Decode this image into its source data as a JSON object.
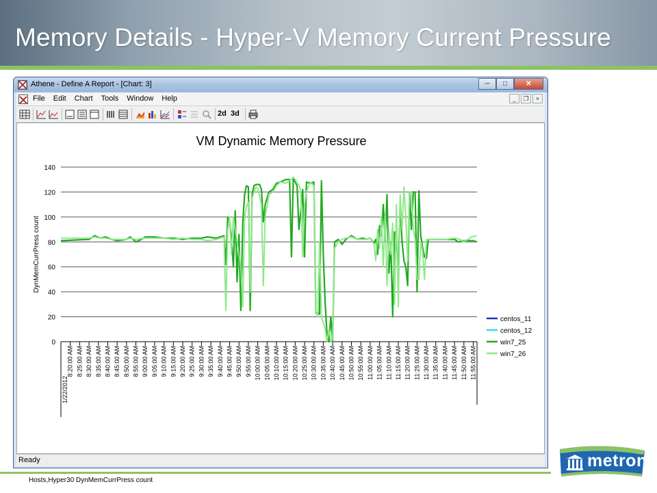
{
  "slide": {
    "title": "Memory Details - Hyper-V Memory Current Pressure"
  },
  "window": {
    "title": "Athene - Define A Report - [Chart: 3]",
    "menu": [
      "File",
      "Edit",
      "Chart",
      "Tools",
      "Window",
      "Help"
    ],
    "toolbar": {
      "label_2d": "2d",
      "label_3d": "3d"
    },
    "status": "Ready"
  },
  "logo": {
    "text": "metron"
  },
  "colors": {
    "header_green": "#8cc266",
    "series_centos_11": "#1f2fbf",
    "series_centos_12": "#33ddee",
    "series_win7_25": "#22a822",
    "series_win7_26": "#8ee88a"
  },
  "chart_data": {
    "type": "line",
    "title": "VM Dynamic Memory Pressure",
    "ylabel": "DynMemCurrPress count",
    "xlabel": "",
    "footnote": "Hosts,Hyper30 DynMemCurrPress count",
    "date_label": "1/22/2012",
    "ylim": [
      0,
      140
    ],
    "yticks": [
      0,
      20,
      40,
      60,
      80,
      100,
      120,
      140
    ],
    "grid": true,
    "legend_position": "right",
    "x_ticks": [
      "8:20:00 AM",
      "8:25:00 AM",
      "8:30:00 AM",
      "8:35:00 AM",
      "8:40:00 AM",
      "8:45:00 AM",
      "8:50:00 AM",
      "8:55:00 AM",
      "9:00:00 AM",
      "9:05:00 AM",
      "9:10:00 AM",
      "9:15:00 AM",
      "9:20:00 AM",
      "9:25:00 AM",
      "9:30:00 AM",
      "9:35:00 AM",
      "9:40:00 AM",
      "9:45:00 AM",
      "9:50:00 AM",
      "9:55:00 AM",
      "10:00:00 AM",
      "10:05:00 AM",
      "10:10:00 AM",
      "10:15:00 AM",
      "10:20:00 AM",
      "10:25:00 AM",
      "10:30:00 AM",
      "10:35:00 AM",
      "10:40:00 AM",
      "10:45:00 AM",
      "10:50:00 AM",
      "10:55:00 AM",
      "11:00:00 AM",
      "11:05:00 AM",
      "11:10:00 AM",
      "11:15:00 AM",
      "11:20:00 AM",
      "11:25:00 AM",
      "11:30:00 AM",
      "11:35:00 AM",
      "11:40:00 AM",
      "11:45:00 AM",
      "11:50:00 AM",
      "11:55:00 AM"
    ],
    "x_range": [
      "8:15 AM",
      "11:57 AM"
    ],
    "series": [
      {
        "name": "centos_11",
        "color": "#1f2fbf",
        "points": []
      },
      {
        "name": "centos_12",
        "color": "#33ddee",
        "points": []
      },
      {
        "name": "win7_25",
        "color": "#22a822",
        "points": [
          [
            "8:15",
            81
          ],
          [
            "8:30",
            82
          ],
          [
            "8:33",
            85
          ],
          [
            "8:36",
            83
          ],
          [
            "8:39",
            84
          ],
          [
            "8:42",
            82
          ],
          [
            "8:45",
            81
          ],
          [
            "8:50",
            82
          ],
          [
            "8:52",
            84
          ],
          [
            "8:55",
            80
          ],
          [
            "8:58",
            82
          ],
          [
            "9:00",
            84
          ],
          [
            "9:05",
            84
          ],
          [
            "9:10",
            83
          ],
          [
            "9:15",
            83
          ],
          [
            "9:20",
            82
          ],
          [
            "9:25",
            83
          ],
          [
            "9:30",
            83
          ],
          [
            "9:33",
            84
          ],
          [
            "9:38",
            83
          ],
          [
            "9:40",
            84
          ],
          [
            "9:42",
            85
          ],
          [
            "9:43",
            62
          ],
          [
            "9:44",
            100
          ],
          [
            "9:45",
            95
          ],
          [
            "9:46",
            84
          ],
          [
            "9:47",
            60
          ],
          [
            "9:48",
            105
          ],
          [
            "9:49",
            48
          ],
          [
            "9:50",
            86
          ],
          [
            "9:51",
            25
          ],
          [
            "9:52",
            95
          ],
          [
            "9:53",
            118
          ],
          [
            "9:54",
            125
          ],
          [
            "9:55",
            124
          ],
          [
            "9:56",
            25
          ],
          [
            "9:57",
            118
          ],
          [
            "9:58",
            125
          ],
          [
            "9:59",
            126
          ],
          [
            "10:01",
            126
          ],
          [
            "10:02",
            122
          ],
          [
            "10:03",
            96
          ],
          [
            "10:04",
            110
          ],
          [
            "10:06",
            120
          ],
          [
            "10:08",
            122
          ],
          [
            "10:10",
            127
          ],
          [
            "10:12",
            128
          ],
          [
            "10:15",
            130
          ],
          [
            "10:17",
            130
          ],
          [
            "10:18",
            68
          ],
          [
            "10:19",
            131
          ],
          [
            "10:20",
            128
          ],
          [
            "10:21",
            125
          ],
          [
            "10:22",
            90
          ],
          [
            "10:23",
            105
          ],
          [
            "10:24",
            122
          ],
          [
            "10:25",
            68
          ],
          [
            "10:26",
            128
          ],
          [
            "10:28",
            127
          ],
          [
            "10:30",
            128
          ],
          [
            "10:31",
            23
          ],
          [
            "10:32",
            23
          ],
          [
            "10:33",
            22
          ],
          [
            "10:34",
            129
          ],
          [
            "10:35",
            70
          ],
          [
            "10:36",
            30
          ],
          [
            "10:37",
            5
          ],
          [
            "10:38",
            0
          ],
          [
            "10:39",
            20
          ],
          [
            "10:40",
            0
          ],
          [
            "10:41",
            80
          ],
          [
            "10:43",
            82
          ],
          [
            "10:45",
            78
          ],
          [
            "10:47",
            82
          ],
          [
            "10:50",
            85
          ],
          [
            "10:53",
            82
          ],
          [
            "10:56",
            83
          ],
          [
            "10:58",
            82
          ],
          [
            "11:00",
            83
          ],
          [
            "11:02",
            79
          ],
          [
            "11:03",
            82
          ],
          [
            "11:04",
            70
          ],
          [
            "11:05",
            93
          ],
          [
            "11:06",
            85
          ],
          [
            "11:07",
            110
          ],
          [
            "11:08",
            80
          ],
          [
            "11:09",
            118
          ],
          [
            "11:10",
            55
          ],
          [
            "11:11",
            80
          ],
          [
            "11:12",
            20
          ],
          [
            "11:13",
            88
          ],
          [
            "11:14",
            85
          ],
          [
            "11:15",
            55
          ],
          [
            "11:16",
            110
          ],
          [
            "11:17",
            80
          ],
          [
            "11:18",
            65
          ],
          [
            "11:19",
            60
          ],
          [
            "11:20",
            45
          ],
          [
            "11:21",
            120
          ],
          [
            "11:22",
            90
          ],
          [
            "11:23",
            120
          ],
          [
            "11:24",
            120
          ],
          [
            "11:25",
            40
          ],
          [
            "11:26",
            121
          ],
          [
            "11:27",
            85
          ],
          [
            "11:28",
            75
          ],
          [
            "11:29",
            68
          ],
          [
            "11:30",
            67
          ],
          [
            "11:31",
            82
          ],
          [
            "11:35",
            82
          ],
          [
            "11:40",
            82
          ],
          [
            "11:45",
            82
          ],
          [
            "11:47",
            80
          ],
          [
            "11:50",
            81
          ],
          [
            "11:55",
            81
          ],
          [
            "11:57",
            80
          ]
        ]
      },
      {
        "name": "win7_26",
        "color": "#8ee88a",
        "points": [
          [
            "8:15",
            83
          ],
          [
            "8:30",
            83
          ],
          [
            "8:33",
            84
          ],
          [
            "8:36",
            83
          ],
          [
            "8:39",
            83
          ],
          [
            "8:42",
            82
          ],
          [
            "8:45",
            82
          ],
          [
            "8:50",
            82
          ],
          [
            "8:52",
            83
          ],
          [
            "8:55",
            82
          ],
          [
            "9:00",
            83
          ],
          [
            "9:05",
            83
          ],
          [
            "9:10",
            83
          ],
          [
            "9:15",
            82
          ],
          [
            "9:20",
            83
          ],
          [
            "9:25",
            82
          ],
          [
            "9:30",
            82
          ],
          [
            "9:33",
            81
          ],
          [
            "9:38",
            82
          ],
          [
            "9:40",
            83
          ],
          [
            "9:42",
            84
          ],
          [
            "9:43",
            25
          ],
          [
            "9:44",
            90
          ],
          [
            "9:45",
            100
          ],
          [
            "9:46",
            70
          ],
          [
            "9:47",
            100
          ],
          [
            "9:48",
            90
          ],
          [
            "9:49",
            80
          ],
          [
            "9:50",
            70
          ],
          [
            "9:51",
            60
          ],
          [
            "9:52",
            28
          ],
          [
            "9:53",
            100
          ],
          [
            "9:54",
            108
          ],
          [
            "9:55",
            112
          ],
          [
            "9:56",
            40
          ],
          [
            "9:57",
            115
          ],
          [
            "9:58",
            120
          ],
          [
            "9:59",
            124
          ],
          [
            "10:00",
            123
          ],
          [
            "10:02",
            110
          ],
          [
            "10:03",
            45
          ],
          [
            "10:04",
            100
          ],
          [
            "10:06",
            118
          ],
          [
            "10:08",
            120
          ],
          [
            "10:10",
            125
          ],
          [
            "10:12",
            128
          ],
          [
            "10:15",
            127
          ],
          [
            "10:17",
            129
          ],
          [
            "10:18",
            130
          ],
          [
            "10:19",
            132
          ],
          [
            "10:20",
            130
          ],
          [
            "10:21",
            127
          ],
          [
            "10:22",
            126
          ],
          [
            "10:23",
            120
          ],
          [
            "10:24",
            68
          ],
          [
            "10:25",
            110
          ],
          [
            "10:26",
            120
          ],
          [
            "10:28",
            128
          ],
          [
            "10:30",
            125
          ],
          [
            "10:31",
            24
          ],
          [
            "10:32",
            20
          ],
          [
            "10:33",
            80
          ],
          [
            "10:34",
            20
          ],
          [
            "10:35",
            15
          ],
          [
            "10:36",
            10
          ],
          [
            "10:37",
            0
          ],
          [
            "10:38",
            10
          ],
          [
            "10:39",
            0
          ],
          [
            "10:40",
            2
          ],
          [
            "10:41",
            75
          ],
          [
            "10:43",
            80
          ],
          [
            "10:45",
            82
          ],
          [
            "10:47",
            83
          ],
          [
            "10:50",
            84
          ],
          [
            "10:53",
            82
          ],
          [
            "10:56",
            82
          ],
          [
            "10:58",
            82
          ],
          [
            "11:00",
            83
          ],
          [
            "11:02",
            78
          ],
          [
            "11:03",
            65
          ],
          [
            "11:04",
            90
          ],
          [
            "11:05",
            75
          ],
          [
            "11:06",
            100
          ],
          [
            "11:07",
            60
          ],
          [
            "11:08",
            103
          ],
          [
            "11:09",
            45
          ],
          [
            "11:10",
            88
          ],
          [
            "11:11",
            70
          ],
          [
            "11:12",
            95
          ],
          [
            "11:13",
            30
          ],
          [
            "11:14",
            110
          ],
          [
            "11:15",
            28
          ],
          [
            "11:16",
            118
          ],
          [
            "11:17",
            90
          ],
          [
            "11:18",
            124
          ],
          [
            "11:19",
            100
          ],
          [
            "11:20",
            65
          ],
          [
            "11:21",
            120
          ],
          [
            "11:22",
            118
          ],
          [
            "11:23",
            90
          ],
          [
            "11:24",
            82
          ],
          [
            "11:25",
            50
          ],
          [
            "11:26",
            50
          ],
          [
            "11:27",
            80
          ],
          [
            "11:28",
            72
          ],
          [
            "11:29",
            50
          ],
          [
            "11:30",
            82
          ],
          [
            "11:35",
            82
          ],
          [
            "11:40",
            82
          ],
          [
            "11:45",
            83
          ],
          [
            "11:48",
            82
          ],
          [
            "11:50",
            80
          ],
          [
            "11:54",
            84
          ],
          [
            "11:57",
            85
          ]
        ]
      }
    ]
  }
}
